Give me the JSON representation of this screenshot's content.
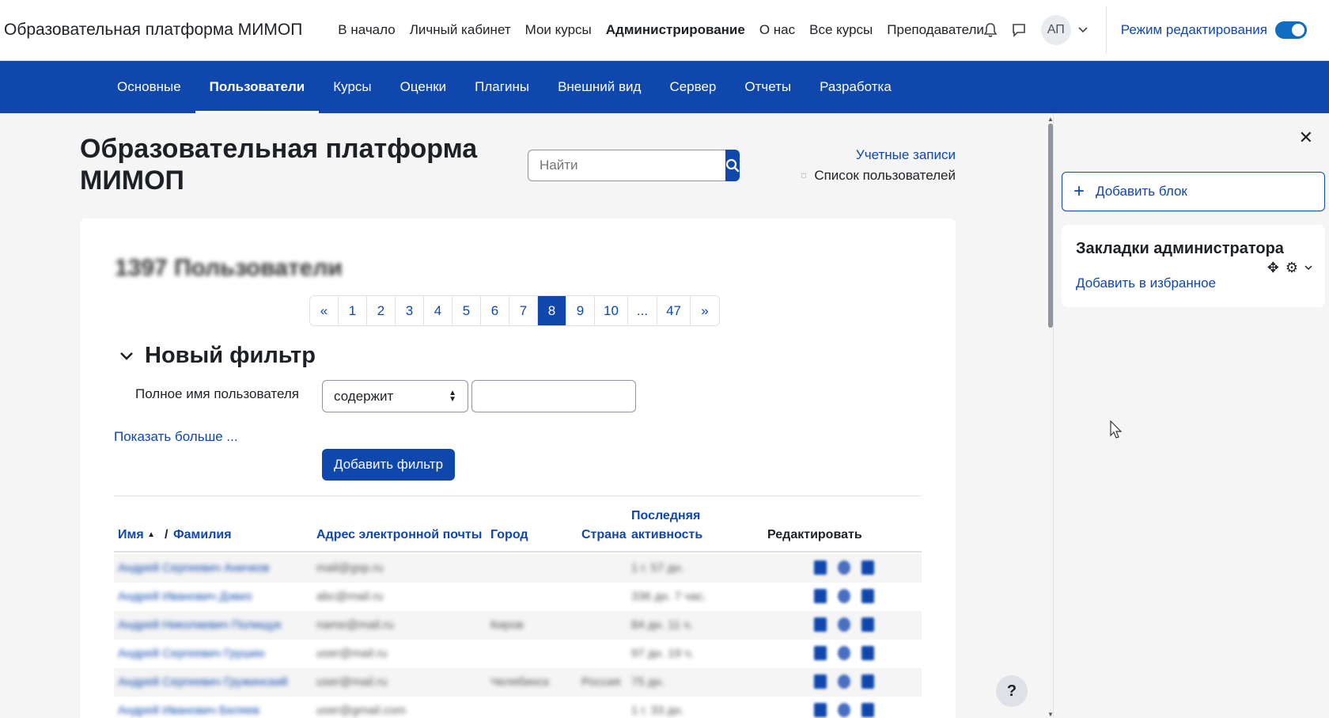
{
  "site": {
    "brand": "Образовательная платформа МИМОП"
  },
  "topnav": [
    "В начало",
    "Личный кабинет",
    "Мои курсы",
    "Администрирование",
    "О нас",
    "Все курсы",
    "Преподаватели"
  ],
  "user": {
    "initials": "АП",
    "edit_mode_label": "Режим редактирования",
    "edit_mode_on": true
  },
  "secnav": [
    "Основные",
    "Пользователи",
    "Курсы",
    "Оценки",
    "Плагины",
    "Внешний вид",
    "Сервер",
    "Отчеты",
    "Разработка"
  ],
  "page": {
    "title": "Образовательная платформа МИМОП",
    "search_placeholder": "Найти",
    "breadcrumb_parent": "Учетные записи",
    "breadcrumb_current": "Список пользователей",
    "count_title": "1397 Пользователи"
  },
  "pagination": {
    "prev": "«",
    "pages": [
      "1",
      "2",
      "3",
      "4",
      "5",
      "6",
      "7",
      "8",
      "9",
      "10",
      "...",
      "47"
    ],
    "current": "8",
    "next": "»"
  },
  "filter": {
    "heading": "Новый фильтр",
    "field_label": "Полное имя пользователя",
    "operator": "содержит",
    "value": "",
    "show_more": "Показать больше ...",
    "add_button": "Добавить фильтр"
  },
  "table": {
    "headers": {
      "first": "Имя",
      "sep": "/",
      "last": "Фамилия",
      "email": "Адрес электронной почты",
      "city": "Город",
      "country": "Страна",
      "activity_1": "Последняя",
      "activity_2": "активность",
      "edit": "Редактировать"
    },
    "rows": [
      {
        "name": "Андрей Сергеевич Аничков",
        "email": "mail@gsp.ru",
        "city": "",
        "country": "",
        "activity": "1 г. 57 дн."
      },
      {
        "name": "Андрей Иванович Дэвиз",
        "email": "abc@mail.ru",
        "city": "",
        "country": "",
        "activity": "336 дн. 7 час."
      },
      {
        "name": "Андрей Николаевич Полищук",
        "email": "name@mail.ru",
        "city": "Киров",
        "country": "",
        "activity": "84 дн. 11 ч."
      },
      {
        "name": "Андрей Сергеевич Грушин",
        "email": "user@mail.ru",
        "city": "",
        "country": "",
        "activity": "97 дн. 19 ч."
      },
      {
        "name": "Андрей Сергеевич Гружинский",
        "email": "user@mail.ru",
        "city": "Челябинск",
        "country": "Россия",
        "activity": "75 дн."
      },
      {
        "name": "Андрей Иванович Беляев",
        "email": "user@gmail.com",
        "city": "",
        "country": "",
        "activity": "1 г. 33 дн."
      }
    ]
  },
  "drawer": {
    "add_block": "Добавить блок",
    "block_title": "Закладки администратора",
    "block_link": "Добавить в избранное"
  },
  "help": "?",
  "colors": {
    "primary": "#0f47ad",
    "background": "#f5f5f5"
  }
}
